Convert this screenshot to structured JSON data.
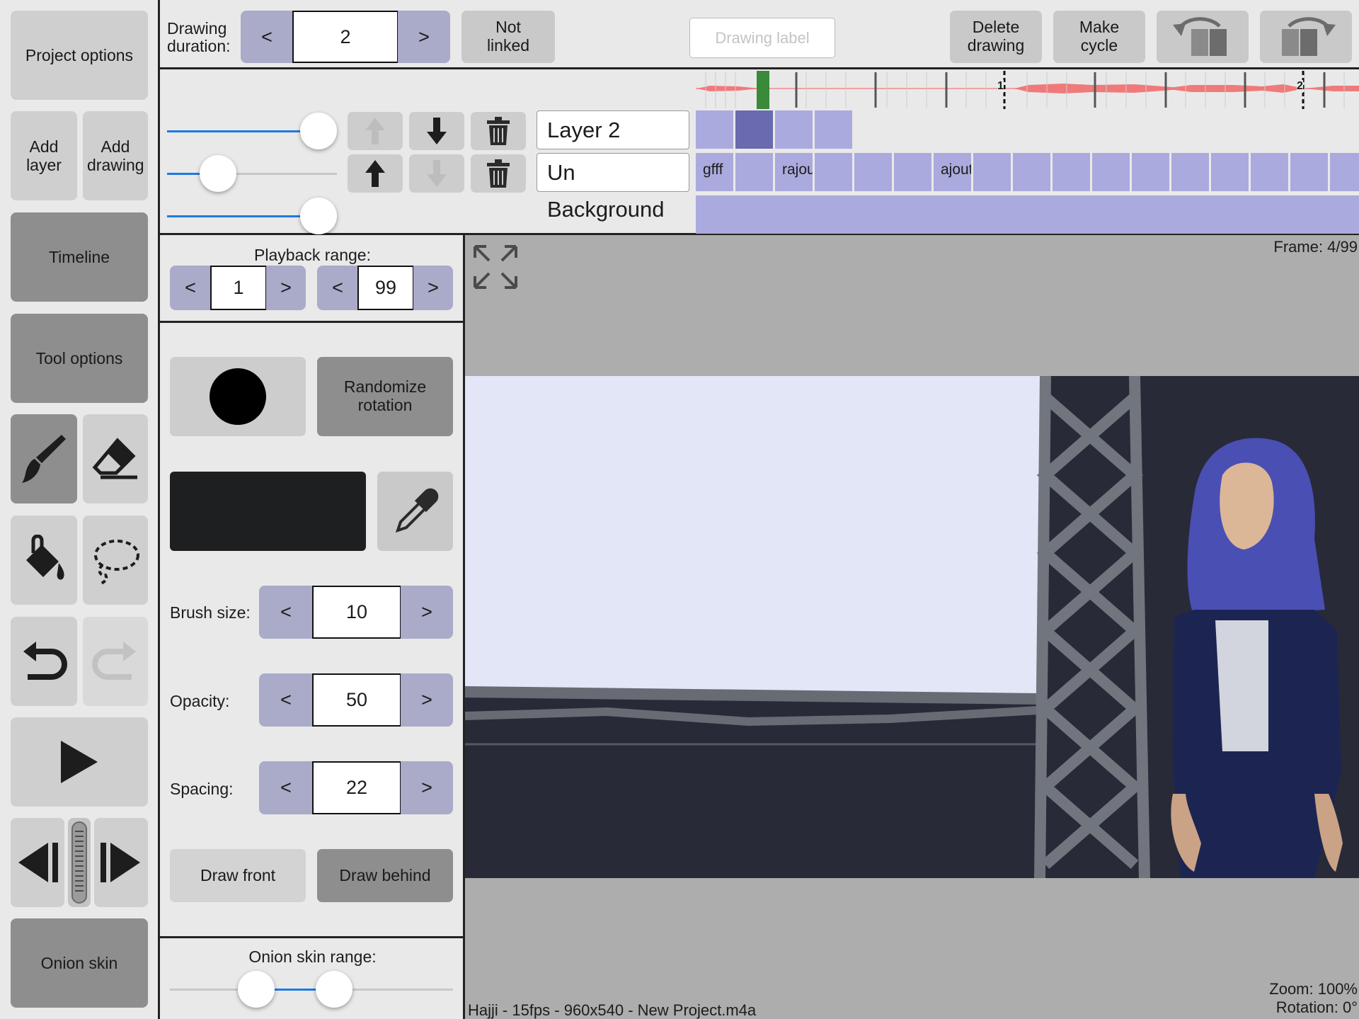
{
  "sidebar": {
    "project_options": "Project options",
    "add_layer": "Add layer",
    "add_drawing": "Add drawing",
    "timeline": "Timeline",
    "tool_options": "Tool options",
    "onion_skin": "Onion skin"
  },
  "toolbar": {
    "drawing_duration_label": "Drawing duration:",
    "prev": "<",
    "next": ">",
    "drawing_duration_value": "2",
    "not_linked": "Not linked",
    "drawing_label_placeholder": "Drawing label",
    "delete_drawing": "Delete drawing",
    "make_cycle": "Make cycle"
  },
  "timeline": {
    "markers": [
      "1",
      "2"
    ]
  },
  "layers": [
    {
      "name": "Layer 2",
      "opacity": 0.9,
      "cells": [
        "",
        "",
        "",
        ""
      ]
    },
    {
      "name": "Un",
      "opacity": 0.15,
      "cells": [
        "gfff",
        "",
        "rajout",
        "",
        "",
        "",
        "ajouta",
        "",
        "",
        "",
        "",
        "",
        "",
        "",
        "",
        "",
        ""
      ]
    },
    {
      "name": "Background",
      "opacity": 0.9
    }
  ],
  "tool_options": {
    "playback_range_label": "Playback range:",
    "playback_start": "1",
    "playback_end": "99",
    "randomize_rotation": "Randomize rotation",
    "brush_size_label": "Brush size:",
    "brush_size": "10",
    "opacity_label": "Opacity:",
    "opacity": "50",
    "spacing_label": "Spacing:",
    "spacing": "22",
    "draw_front": "Draw front",
    "draw_behind": "Draw behind",
    "onion_skin_range_label": "Onion skin range:",
    "color": "#1e1f21"
  },
  "canvas": {
    "frame": "Frame: 4/99",
    "zoom": "Zoom: 100%",
    "rotation": "Rotation: 0°",
    "project_info": "Hajji - 15fps - 960x540 - New Project.m4a"
  },
  "colors": {
    "accent_purple": "#aaaac9",
    "cell_purple": "#aaaade",
    "selected_cell": "#6a6ab0",
    "slider_blue": "#1f7ae0",
    "playhead_green": "#3a8a3a",
    "waveform_red": "#f07a7a"
  }
}
